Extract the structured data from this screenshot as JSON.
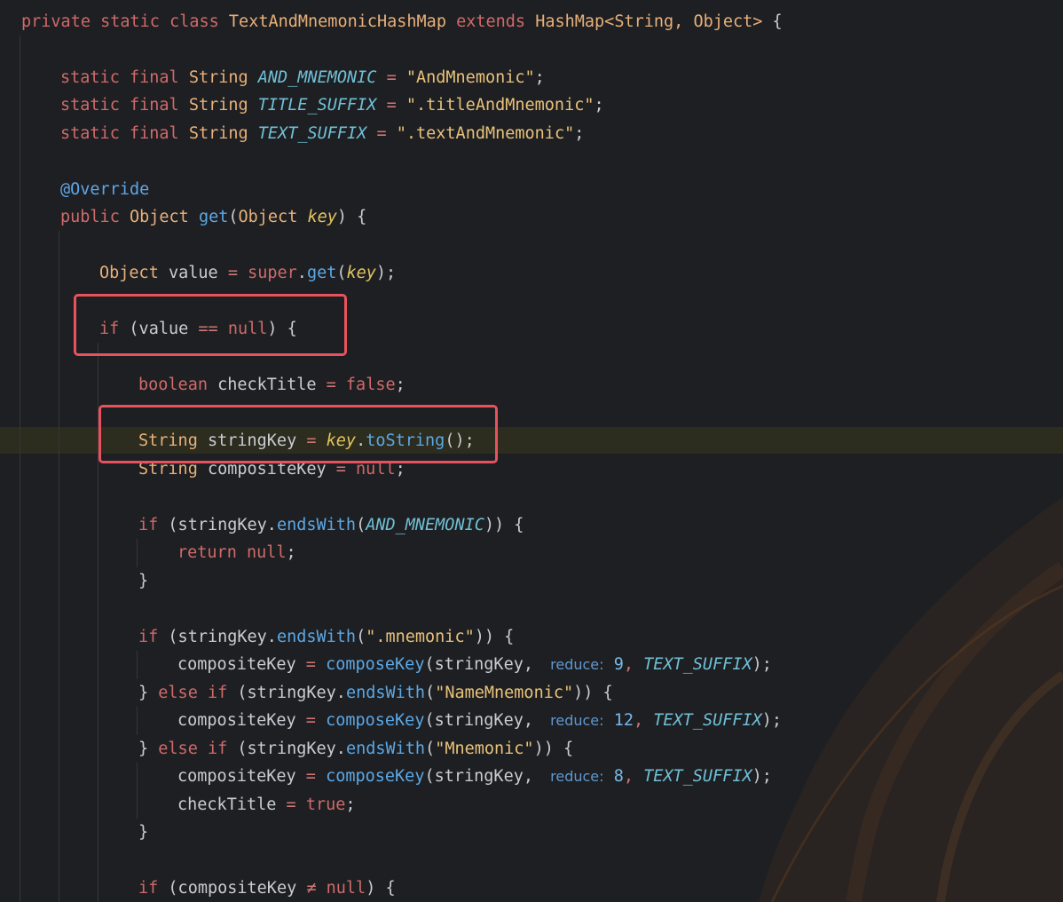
{
  "code": {
    "class_decl": {
      "private_kw": "private",
      "static_kw": "static",
      "class_kw": "class",
      "class_name": "TextAndMnemonicHashMap",
      "extends_kw": "extends",
      "superclass": "HashMap<String,",
      "type_param2": "Object>",
      "open_brace": "{"
    },
    "const1": {
      "static_kw": "static",
      "final_kw": "final",
      "type": "String",
      "name": "AND_MNEMONIC",
      "eq": "=",
      "value": "\"AndMnemonic\"",
      "semi": ";"
    },
    "const2": {
      "static_kw": "static",
      "final_kw": "final",
      "type": "String",
      "name": "TITLE_SUFFIX",
      "eq": "=",
      "value": "\".titleAndMnemonic\"",
      "semi": ";"
    },
    "const3": {
      "static_kw": "static",
      "final_kw": "final",
      "type": "String",
      "name": "TEXT_SUFFIX",
      "eq": "=",
      "value": "\".textAndMnemonic\"",
      "semi": ";"
    },
    "annotation": "@Override",
    "method_decl": {
      "public_kw": "public",
      "return_type": "Object",
      "name": "get",
      "open_paren": "(",
      "param_type": "Object",
      "param": "key",
      "close": ") {"
    },
    "value_decl": {
      "type": "Object",
      "var": "value",
      "eq": "=",
      "super_kw": "super",
      "dot": ".",
      "call": "get",
      "open": "(",
      "arg": "key",
      "close": ");"
    },
    "if_null": {
      "if_kw": "if",
      "open": "(value",
      "eq": "==",
      "null_kw": "null",
      "close": ") {"
    },
    "check_title": {
      "type": "boolean",
      "var": "checkTitle",
      "eq": "=",
      "false_kw": "false",
      "semi": ";"
    },
    "string_key": {
      "type": "String",
      "var": "stringKey",
      "eq": "=",
      "recv": "key",
      "dot": ".",
      "call": "toString",
      "close": "();"
    },
    "composite_key": {
      "type": "String",
      "var": "compositeKey",
      "eq": "=",
      "null_kw": "null",
      "semi": ";"
    },
    "if_and": {
      "if_kw": "if",
      "open": "(stringKey.",
      "call": "endsWith",
      "p": "(",
      "arg": "AND_MNEMONIC",
      "close": ")) {"
    },
    "return_null": {
      "return_kw": "return",
      "null_kw": "null",
      "semi": ";"
    },
    "close_brace": "}",
    "if_mnemonic": {
      "if_kw": "if",
      "open": "(stringKey.",
      "call": "endsWith",
      "p": "(",
      "arg": "\".mnemonic\"",
      "close": ")) {"
    },
    "assign1": {
      "var": "compositeKey",
      "eq": "=",
      "call": "composeKey",
      "p": "(stringKey,",
      "hint": "reduce:",
      "num": "9",
      "comma": ",",
      "arg": "TEXT_SUFFIX",
      "close": ");"
    },
    "else_if_name": {
      "brace": "}",
      "else_kw": "else",
      "if_kw": "if",
      "open": "(stringKey.",
      "call": "endsWith",
      "p": "(",
      "arg": "\"NameMnemonic\"",
      "close": ")) {"
    },
    "assign2": {
      "var": "compositeKey",
      "eq": "=",
      "call": "composeKey",
      "p": "(stringKey,",
      "hint": "reduce:",
      "num": "12",
      "comma": ",",
      "arg": "TEXT_SUFFIX",
      "close": ");"
    },
    "else_if_mn": {
      "brace": "}",
      "else_kw": "else",
      "if_kw": "if",
      "open": "(stringKey.",
      "call": "endsWith",
      "p": "(",
      "arg": "\"Mnemonic\"",
      "close": ")) {"
    },
    "assign3": {
      "var": "compositeKey",
      "eq": "=",
      "call": "composeKey",
      "p": "(stringKey,",
      "hint": "reduce:",
      "num": "8",
      "comma": ",",
      "arg": "TEXT_SUFFIX",
      "close": ");"
    },
    "check_true": {
      "var": "checkTitle",
      "eq": "=",
      "true_kw": "true",
      "semi": ";"
    },
    "if_not_null": {
      "if_kw": "if",
      "open": "(compositeKey",
      "neq": "≠",
      "null_kw": "null",
      "close": ") {"
    }
  },
  "colors": {
    "background": "#1e1f22",
    "highlight_box": "#e8525c",
    "keyword": "#cf6a6a",
    "string": "#e8c27a",
    "field": "#6fc0d6",
    "method": "#5ba8e6"
  }
}
